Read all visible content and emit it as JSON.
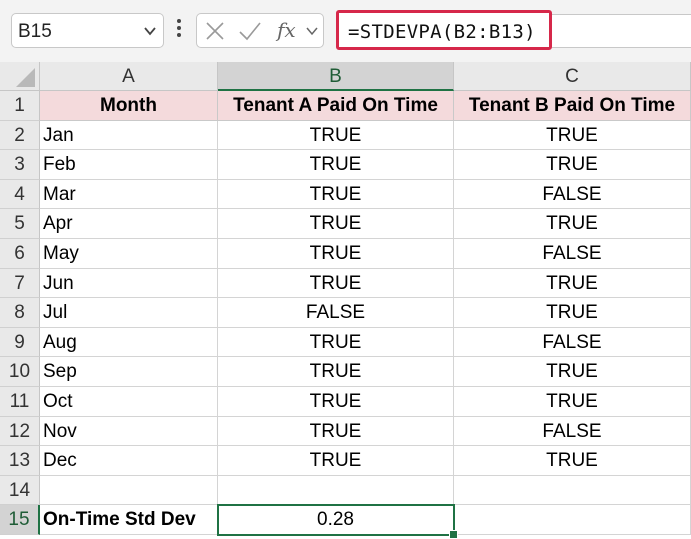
{
  "formula_bar": {
    "name_box": "B15",
    "formula": "=STDEVPA(B2:B13)",
    "fx_label": "fx"
  },
  "columns": [
    "A",
    "B",
    "C"
  ],
  "selected_column": "B",
  "selected_row": "15",
  "rows": [
    {
      "num": "1",
      "a": "Month",
      "b": "Tenant A Paid On Time",
      "c": "Tenant B Paid On Time"
    },
    {
      "num": "2",
      "a": "Jan",
      "b": "TRUE",
      "c": "TRUE"
    },
    {
      "num": "3",
      "a": "Feb",
      "b": "TRUE",
      "c": "TRUE"
    },
    {
      "num": "4",
      "a": "Mar",
      "b": "TRUE",
      "c": "FALSE"
    },
    {
      "num": "5",
      "a": "Apr",
      "b": "TRUE",
      "c": "TRUE"
    },
    {
      "num": "6",
      "a": "May",
      "b": "TRUE",
      "c": "FALSE"
    },
    {
      "num": "7",
      "a": "Jun",
      "b": "TRUE",
      "c": "TRUE"
    },
    {
      "num": "8",
      "a": "Jul",
      "b": "FALSE",
      "c": "TRUE"
    },
    {
      "num": "9",
      "a": "Aug",
      "b": "TRUE",
      "c": "FALSE"
    },
    {
      "num": "10",
      "a": "Sep",
      "b": "TRUE",
      "c": "TRUE"
    },
    {
      "num": "11",
      "a": "Oct",
      "b": "TRUE",
      "c": "TRUE"
    },
    {
      "num": "12",
      "a": "Nov",
      "b": "TRUE",
      "c": "FALSE"
    },
    {
      "num": "13",
      "a": "Dec",
      "b": "TRUE",
      "c": "TRUE"
    },
    {
      "num": "14",
      "a": "",
      "b": "",
      "c": ""
    },
    {
      "num": "15",
      "a": "On-Time Std Dev",
      "b": "0.28",
      "c": ""
    }
  ],
  "colors": {
    "header_fill": "#f4dadc",
    "selection": "#1f7244",
    "formula_highlight": "#d6284a"
  }
}
